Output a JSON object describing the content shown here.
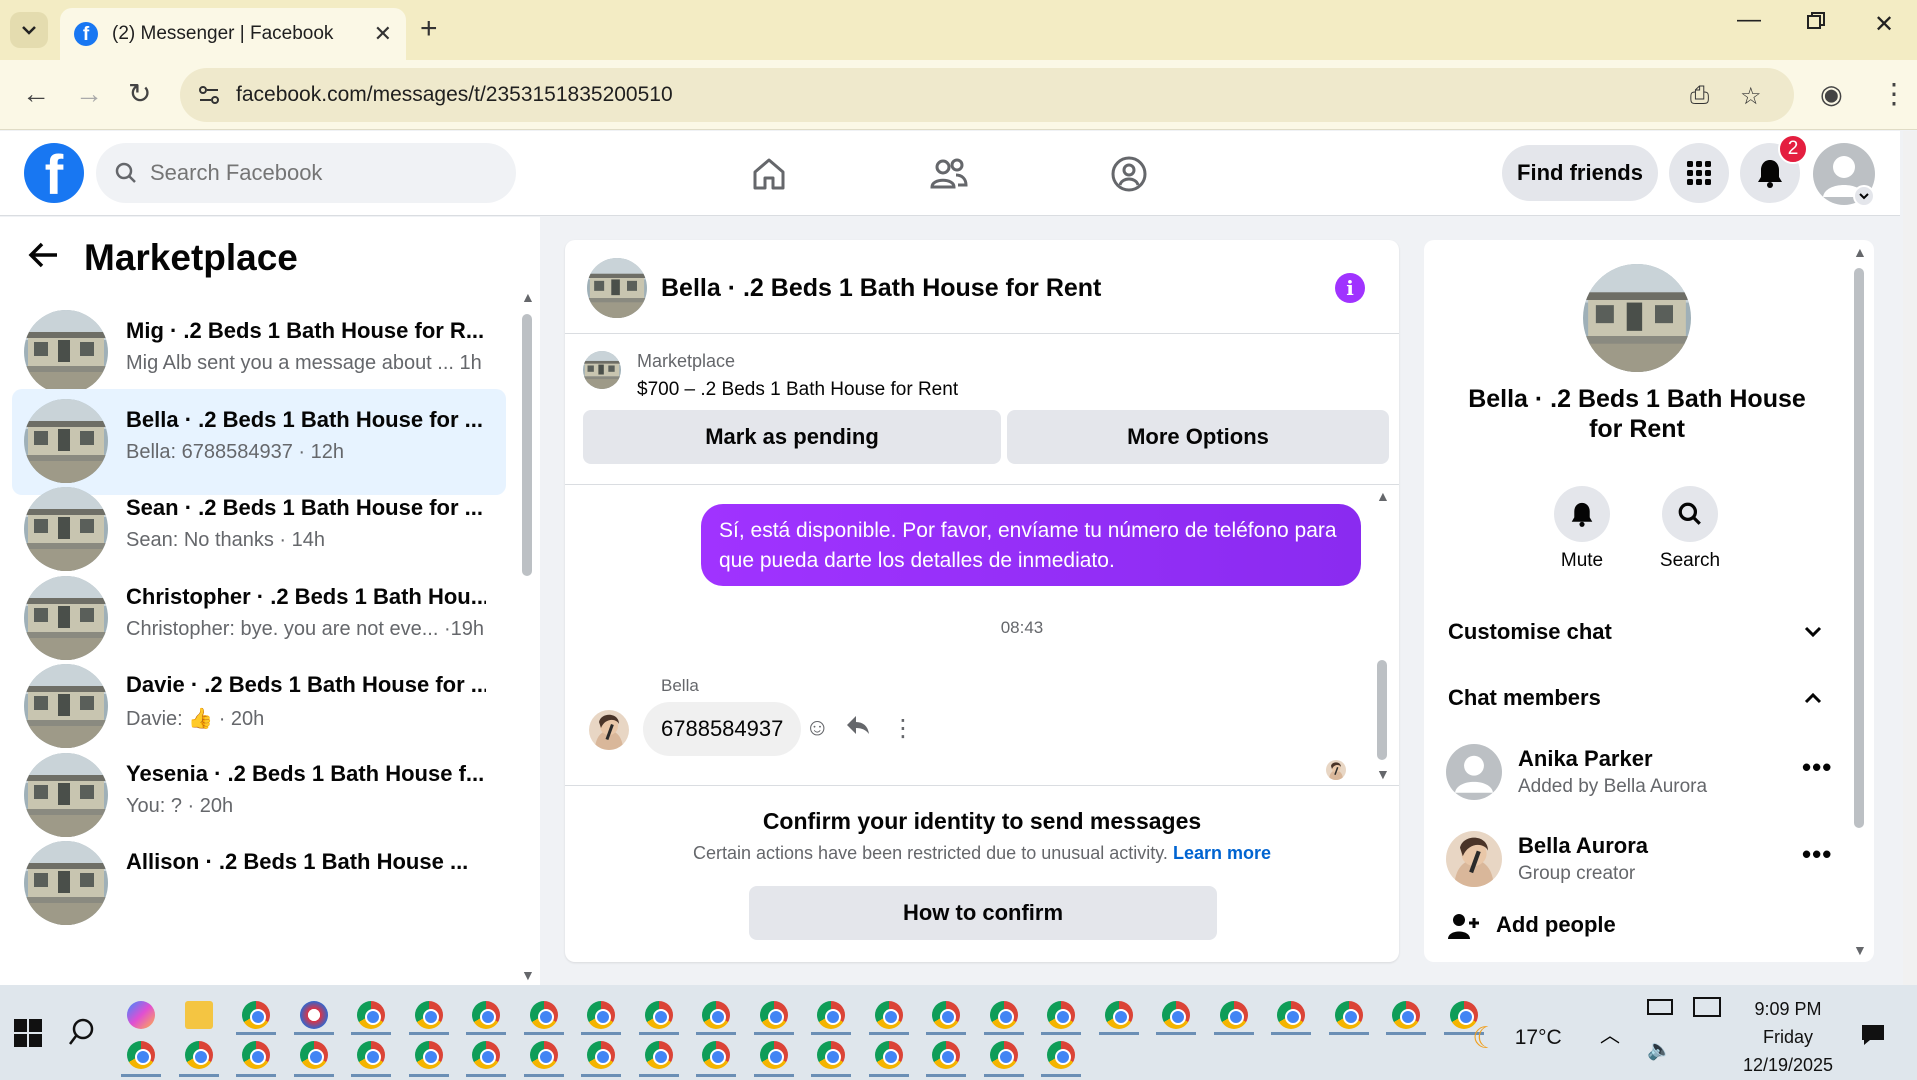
{
  "browser": {
    "tab_title": "(2) Messenger | Facebook",
    "url": "facebook.com/messages/t/2353151835200510"
  },
  "fb_header": {
    "search_placeholder": "Search Facebook",
    "find_friends": "Find friends",
    "notification_count": "2"
  },
  "sidebar": {
    "title": "Marketplace",
    "conversations": [
      {
        "name": "Mig · .2 Beds 1 Bath House for R...",
        "preview": "Mig Alb sent you a message about ... ",
        "time": "1h",
        "active": false
      },
      {
        "name": "Bella · .2 Beds 1 Bath House for ...",
        "preview": "Bella: 6788584937 · ",
        "time": "12h",
        "active": true
      },
      {
        "name": "Sean · .2 Beds 1 Bath House for ...",
        "preview": "Sean: No thanks · ",
        "time": "14h",
        "active": false
      },
      {
        "name": "Christopher · .2 Beds 1 Bath Hou...",
        "preview": "Christopher: bye. you are not eve...   ·",
        "time": "19h",
        "active": false
      },
      {
        "name": "Davie · .2 Beds 1 Bath House for ...",
        "preview": "Davie: 👍 · ",
        "time": "20h",
        "active": false
      },
      {
        "name": "Yesenia · .2 Beds 1 Bath House f...",
        "preview": "You: ? · ",
        "time": "20h",
        "active": false
      },
      {
        "name": "Allison · .2 Beds 1 Bath House ...",
        "preview": "",
        "time": "",
        "active": false
      }
    ]
  },
  "chat": {
    "title": "Bella · .2 Beds 1 Bath House for Rent",
    "listing_label": "Marketplace",
    "listing_price": "$700 – .2 Beds 1 Bath House for Rent",
    "mark_pending": "Mark as pending",
    "more_options": "More Options",
    "outgoing_message": "Sí, está disponible. Por favor, envíame tu número de teléfono para que pueda darte los detalles de inmediato.",
    "timestamp": "08:43",
    "incoming_sender": "Bella",
    "incoming_message": "6788584937",
    "confirm_heading": "Confirm your identity to send messages",
    "confirm_text": "Certain actions have been restricted due to unusual activity.",
    "learn_more": "Learn more",
    "how_to_confirm": "How to confirm"
  },
  "info_panel": {
    "title": "Bella · .2 Beds 1 Bath House for Rent",
    "mute": "Mute",
    "search": "Search",
    "customise_chat": "Customise chat",
    "chat_members": "Chat members",
    "members": [
      {
        "name": "Anika Parker",
        "role": "Added by Bella Aurora"
      },
      {
        "name": "Bella Aurora",
        "role": "Group creator"
      }
    ],
    "add_people": "Add people"
  },
  "taskbar": {
    "temperature": "17°C",
    "time": "9:09 PM",
    "day": "Friday",
    "date": "12/19/2025"
  },
  "colors": {
    "fb_blue": "#1877f2",
    "messenger_purple": "#a033ff",
    "badge_red": "#e41e3f",
    "active_conv_bg": "#e7f3ff"
  }
}
